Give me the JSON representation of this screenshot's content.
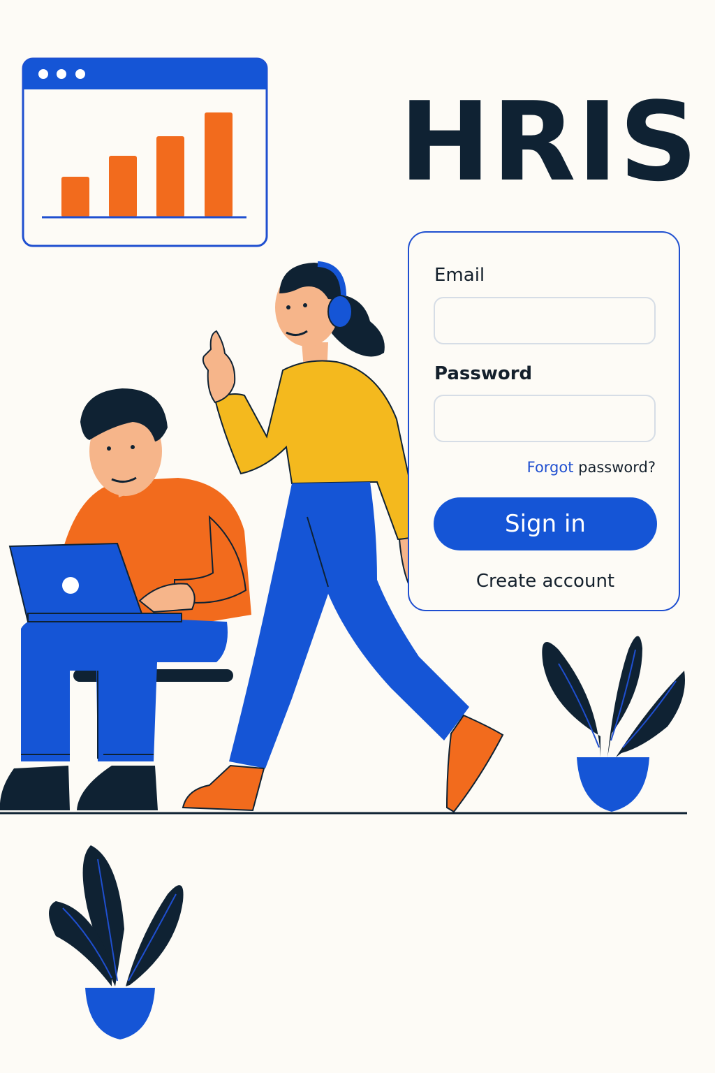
{
  "app": {
    "title": "HRIS"
  },
  "login": {
    "email_label": "Email",
    "email_value": "",
    "password_label": "Password",
    "password_value": "",
    "forgot_prefix": "Forgot",
    "forgot_suffix": " password?",
    "signin_label": "Sign in",
    "create_account_label": "Create account"
  },
  "icons": {
    "window": "browser-window-icon",
    "chart": "bar-chart-icon",
    "plant": "potted-plant-icon"
  },
  "colors": {
    "primary": "#1555d6",
    "accent_orange": "#f26b1d",
    "shirt_yellow": "#f4b91e",
    "ink": "#0f2233",
    "background": "#fdfbf6"
  }
}
